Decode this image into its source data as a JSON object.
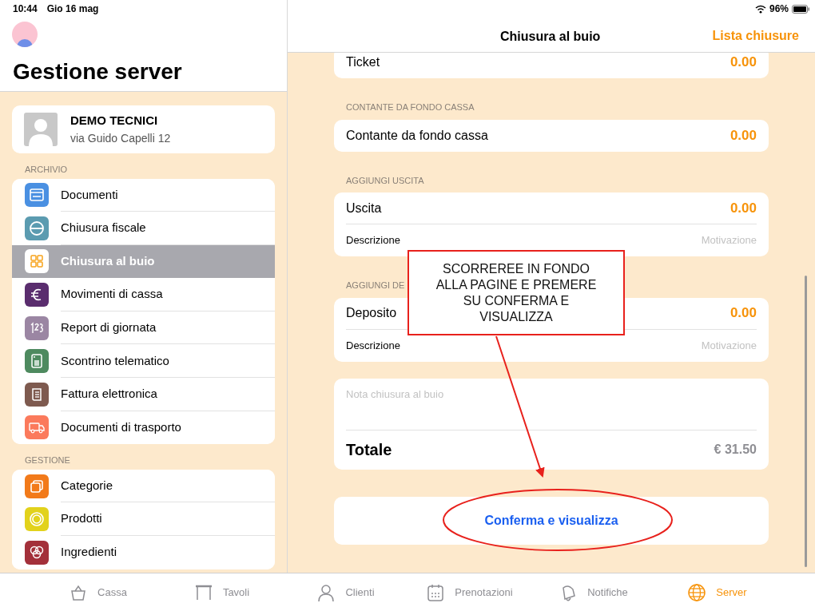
{
  "status_bar": {
    "time": "10:44",
    "date": "Gio 16 mag",
    "battery": "96%"
  },
  "sidebar": {
    "title": "Gestione server",
    "profile": {
      "name": "DEMO TECNICI",
      "address": "via Guido Capelli 12"
    },
    "sections": [
      {
        "header": "ARCHIVIO",
        "items": [
          {
            "label": "Documenti",
            "kind": "folder",
            "color": "#4a90e2",
            "selected": false
          },
          {
            "label": "Chiusura fiscale",
            "kind": "minus",
            "color": "#5b9bb0",
            "selected": false
          },
          {
            "label": "Chiusura al buio",
            "kind": "grid",
            "color": "#ffffff",
            "selected": true
          },
          {
            "label": "Movimenti di cassa",
            "kind": "euro",
            "color": "#5a2d6e",
            "selected": false
          },
          {
            "label": "Report di giornata",
            "kind": "numbers",
            "color": "#9b86a3",
            "selected": false
          },
          {
            "label": "Scontrino telematico",
            "kind": "register",
            "color": "#4e8a5f",
            "selected": false
          },
          {
            "label": "Fattura elettronica",
            "kind": "document",
            "color": "#7e5a4f",
            "selected": false
          },
          {
            "label": "Documenti di trasporto",
            "kind": "truck",
            "color": "#fb7a5c",
            "selected": false
          }
        ]
      },
      {
        "header": "GESTIONE",
        "items": [
          {
            "label": "Categorie",
            "kind": "squares",
            "color": "#f27a1a",
            "selected": false
          },
          {
            "label": "Prodotti",
            "kind": "ring",
            "color": "#e2d21c",
            "selected": false
          },
          {
            "label": "Ingredienti",
            "kind": "circles",
            "color": "#a3303a",
            "selected": false
          }
        ]
      }
    ]
  },
  "detail": {
    "title": "Chiusura al buio",
    "action": "Lista chiusure",
    "sections": [
      {
        "rows": [
          {
            "kind": "amount",
            "label": "Ticket",
            "value": "0.00"
          }
        ]
      },
      {
        "header": "CONTANTE DA FONDO CASSA",
        "rows": [
          {
            "kind": "amount",
            "label": "Contante da fondo cassa",
            "value": "0.00"
          }
        ]
      },
      {
        "header": "AGGIUNGI USCITA",
        "rows": [
          {
            "kind": "amount",
            "label": "Uscita",
            "value": "0.00"
          },
          {
            "kind": "text",
            "label": "Descrizione",
            "placeholder": "Motivazione"
          }
        ]
      },
      {
        "header": "AGGIUNGI DE",
        "rows": [
          {
            "kind": "amount",
            "label": "Deposito",
            "value": "0.00"
          },
          {
            "kind": "text",
            "label": "Descrizione",
            "placeholder": "Motivazione"
          }
        ]
      }
    ],
    "note": {
      "placeholder": "Nota chiusura al buio",
      "total_label": "Totale",
      "total_value": "€ 31.50"
    },
    "button": "Conferma e visualizza"
  },
  "annotation": {
    "text": "SCORREREE IN FONDO ALLA PAGINE E PREMERE SU CONFERMA E VISUALIZZA"
  },
  "tab_bar": [
    {
      "label": "Cassa",
      "kind": "basket",
      "selected": false
    },
    {
      "label": "Tavoli",
      "kind": "table",
      "selected": false
    },
    {
      "label": "Clienti",
      "kind": "person",
      "selected": false
    },
    {
      "label": "Prenotazioni",
      "kind": "calendar",
      "selected": false
    },
    {
      "label": "Notifiche",
      "kind": "bell",
      "selected": false
    },
    {
      "label": "Server",
      "kind": "globe",
      "selected": true
    }
  ]
}
